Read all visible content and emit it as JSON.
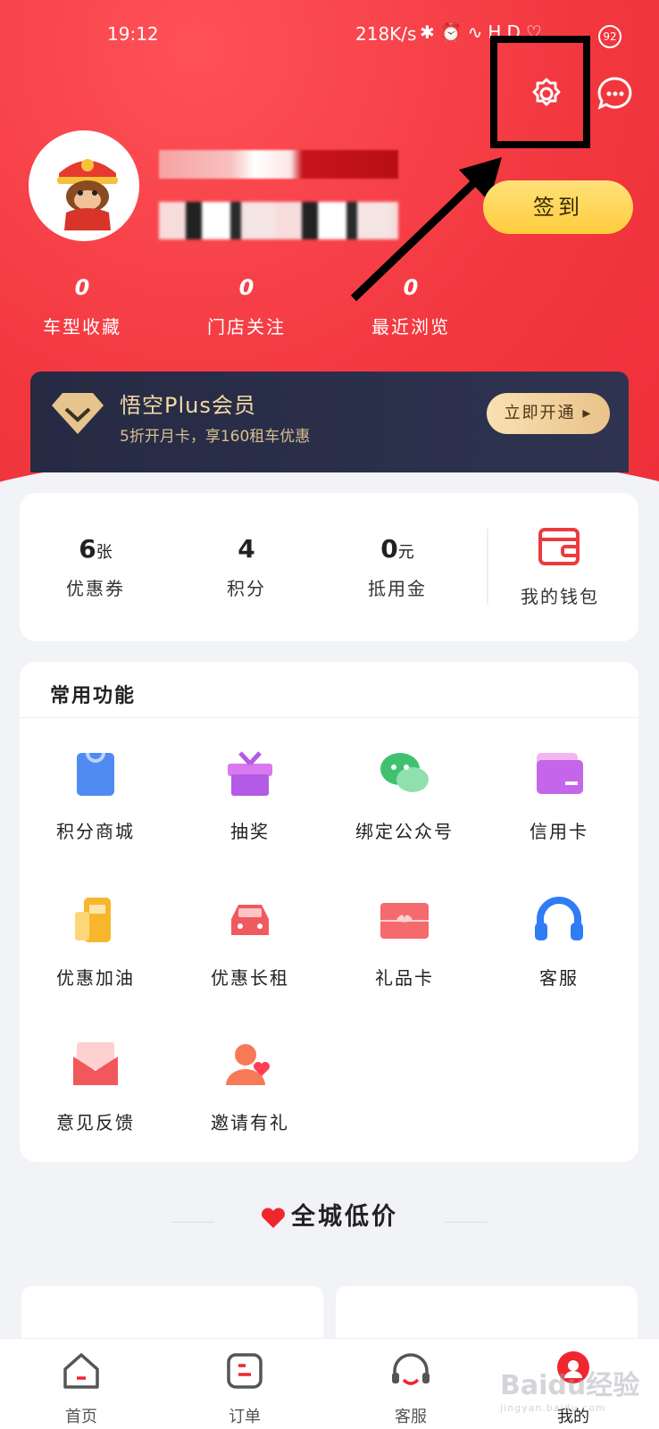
{
  "status_bar": {
    "time": "19:12",
    "net_speed": "218K/s",
    "battery": "92"
  },
  "header": {
    "settings_icon": "gear-icon",
    "message_icon": "chat-bubble-icon",
    "signin_label": "签到"
  },
  "profile": {
    "stats": [
      {
        "value": "0",
        "label": "车型收藏"
      },
      {
        "value": "0",
        "label": "门店关注"
      },
      {
        "value": "0",
        "label": "最近浏览"
      }
    ]
  },
  "plus_banner": {
    "title": "悟空Plus会员",
    "subtitle": "5折开月卡，享160租车优惠",
    "button": "立即开通 ▸"
  },
  "wallet": {
    "items": [
      {
        "value": "6",
        "unit": "张",
        "label": "优惠券"
      },
      {
        "value": "4",
        "unit": "",
        "label": "积分"
      },
      {
        "value": "0",
        "unit": "元",
        "label": "抵用金"
      }
    ],
    "wallet_label": "我的钱包"
  },
  "functions": {
    "title": "常用功能",
    "items": [
      {
        "label": "积分商城",
        "icon": "shopping-bag-icon"
      },
      {
        "label": "抽奖",
        "icon": "gift-box-icon"
      },
      {
        "label": "绑定公众号",
        "icon": "wechat-icon"
      },
      {
        "label": "信用卡",
        "icon": "credit-card-icon"
      },
      {
        "label": "优惠加油",
        "icon": "fuel-icon"
      },
      {
        "label": "优惠长租",
        "icon": "car-icon"
      },
      {
        "label": "礼品卡",
        "icon": "gift-card-icon"
      },
      {
        "label": "客服",
        "icon": "headset-icon"
      },
      {
        "label": "意见反馈",
        "icon": "envelope-icon"
      },
      {
        "label": "邀请有礼",
        "icon": "invite-user-icon"
      }
    ]
  },
  "section": {
    "low_price_title": "全城低价"
  },
  "tabbar": {
    "tabs": [
      {
        "label": "首页",
        "icon": "home-icon"
      },
      {
        "label": "订单",
        "icon": "order-icon"
      },
      {
        "label": "客服",
        "icon": "service-icon"
      },
      {
        "label": "我的",
        "icon": "mine-icon"
      }
    ]
  },
  "watermark": {
    "text": "Baidu经验",
    "sub": "jingyan.baidu.com"
  },
  "colors": {
    "brand_red": "#f2373f",
    "signin_yellow": "#ffcc3d",
    "plus_navy": "#262a43",
    "gold": "#f3d9a5"
  }
}
